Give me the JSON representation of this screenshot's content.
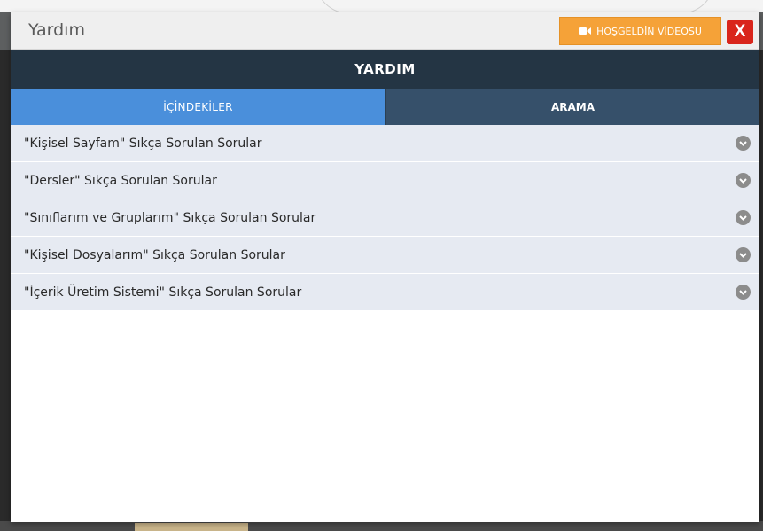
{
  "modal": {
    "title": "Yardım",
    "welcome_button": "HOŞGELDİN VİDEOSU",
    "close_button": "X"
  },
  "help": {
    "title": "YARDIM",
    "tabs": [
      {
        "label": "İÇİNDEKİLER",
        "active": true
      },
      {
        "label": "ARAMA",
        "active": false
      }
    ],
    "items": [
      {
        "label": "\"Kişisel Sayfam\" Sıkça Sorulan Sorular"
      },
      {
        "label": "\"Dersler\" Sıkça Sorulan Sorular"
      },
      {
        "label": "\"Sınıflarım ve Gruplarım\" Sıkça Sorulan Sorular"
      },
      {
        "label": "\"Kişisel Dosyalarım\" Sıkça Sorulan Sorular"
      },
      {
        "label": "\"İçerik Üretim Sistemi\" Sıkça Sorulan Sorular"
      }
    ]
  },
  "colors": {
    "header_dark": "#243544",
    "tab_active": "#4a8fdb",
    "tab_inactive": "#36506a",
    "welcome_button": "#f5a238",
    "close_button": "#d9261c",
    "list_item_bg": "#e6eaf2"
  },
  "icons": {
    "welcome_button_icon": "video-camera-icon",
    "item_icon": "chevron-down-icon"
  }
}
